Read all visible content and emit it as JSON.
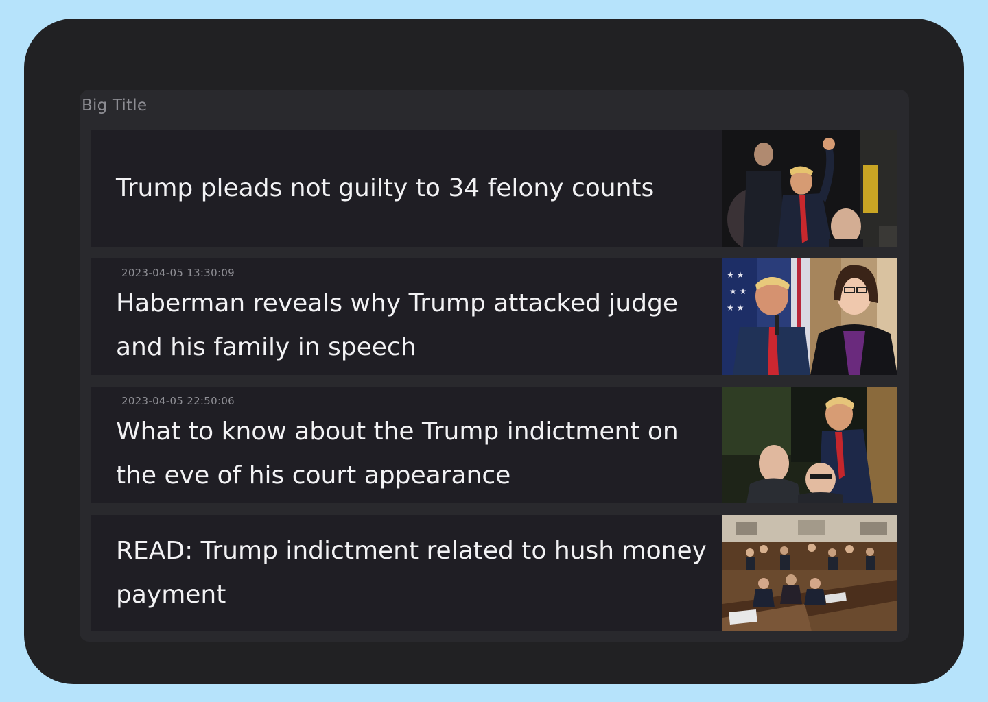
{
  "widget": {
    "title": "Big Title"
  },
  "news": [
    {
      "headline": "Trump pleads not guilty to 34 felony counts",
      "timestamp": "",
      "thumbnail": "photo-trump-waving"
    },
    {
      "headline": "Haberman reveals why Trump attacked judge and his family in speech",
      "timestamp": "2023-04-05 13:30:09",
      "thumbnail": "photo-trump-and-haberman"
    },
    {
      "headline": "What to know about the Trump indictment on the eve of his court appearance",
      "timestamp": "2023-04-05 22:50:06",
      "thumbnail": "photo-trump-court-arrival"
    },
    {
      "headline": "READ: Trump indictment related to hush money payment",
      "timestamp": "",
      "thumbnail": "photo-courtroom"
    }
  ],
  "colors": {
    "page_background": "#b6e3fb",
    "device_background": "#212123",
    "widget_background": "#29292d",
    "card_background": "#1f1e24",
    "headline_text": "#f2f2f4",
    "muted_text": "#8e8e94"
  }
}
